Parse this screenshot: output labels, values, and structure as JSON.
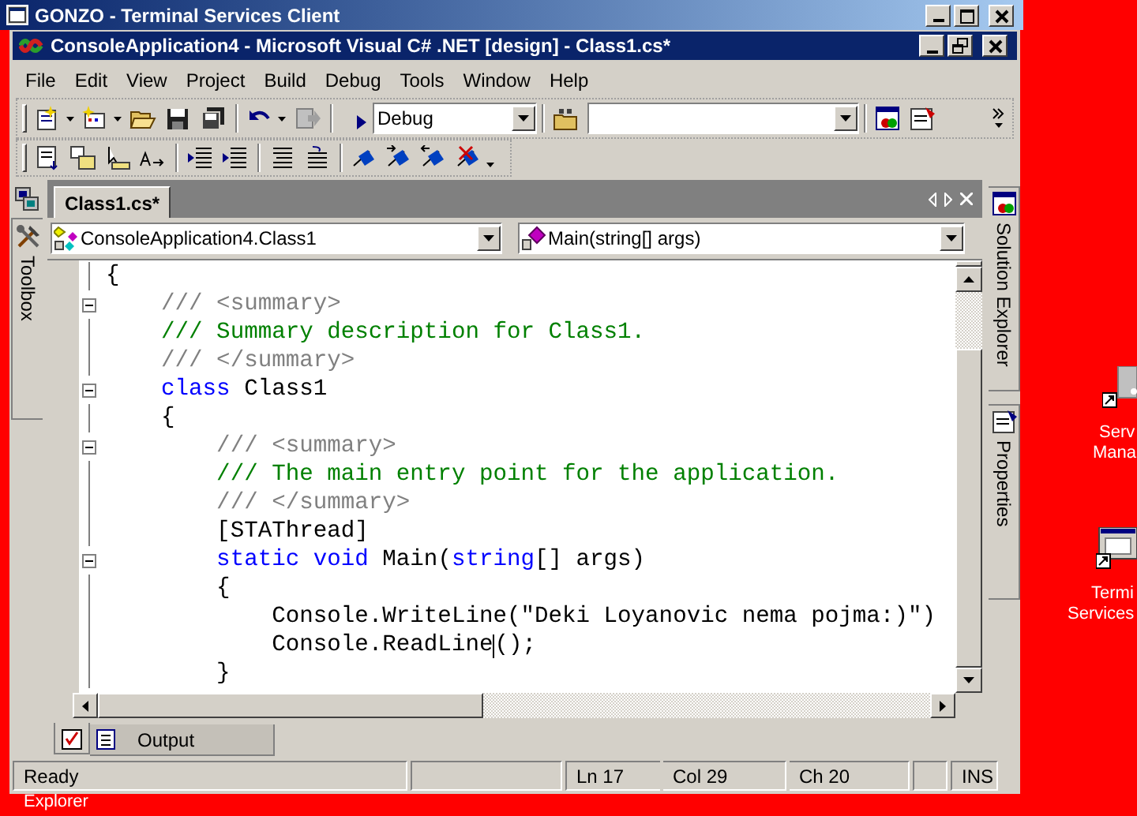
{
  "terminal_window": {
    "title": "GONZO - Terminal Services Client"
  },
  "window": {
    "title": "ConsoleApplication4 - Microsoft Visual C# .NET [design] - Class1.cs*"
  },
  "menu": [
    "File",
    "Edit",
    "View",
    "Project",
    "Build",
    "Debug",
    "Tools",
    "Window",
    "Help"
  ],
  "toolbar": {
    "configuration": "Debug"
  },
  "left_dock": [
    {
      "label": "Toolbox"
    }
  ],
  "right_dock": [
    {
      "label": "Solution Explorer"
    },
    {
      "label": "Properties"
    }
  ],
  "document_tabs": [
    {
      "label": "Class1.cs*",
      "selected": true
    }
  ],
  "type_dropdown": "ConsoleApplication4.Class1",
  "member_dropdown": "Main(string[] args)",
  "code_lines": [
    {
      "fold": false,
      "tokens": [
        {
          "kind": "plain",
          "text": "{"
        }
      ]
    },
    {
      "fold": true,
      "tokens": [
        {
          "kind": "doc_tag",
          "text": "    /// <summary>"
        }
      ]
    },
    {
      "fold": false,
      "tokens": [
        {
          "kind": "comment",
          "text": "    /// Summary description for Class1."
        }
      ]
    },
    {
      "fold": false,
      "tokens": [
        {
          "kind": "doc_tag",
          "text": "    /// </summary>"
        }
      ]
    },
    {
      "fold": true,
      "tokens": [
        {
          "kind": "keyword",
          "text": "    class"
        },
        {
          "kind": "plain",
          "text": " Class1"
        }
      ]
    },
    {
      "fold": false,
      "tokens": [
        {
          "kind": "plain",
          "text": "    {"
        }
      ]
    },
    {
      "fold": true,
      "tokens": [
        {
          "kind": "doc_tag",
          "text": "        /// <summary>"
        }
      ]
    },
    {
      "fold": false,
      "tokens": [
        {
          "kind": "comment",
          "text": "        /// The main entry point for the application."
        }
      ]
    },
    {
      "fold": false,
      "tokens": [
        {
          "kind": "doc_tag",
          "text": "        /// </summary>"
        }
      ]
    },
    {
      "fold": false,
      "tokens": [
        {
          "kind": "plain",
          "text": "        [STAThread]"
        }
      ]
    },
    {
      "fold": true,
      "tokens": [
        {
          "kind": "keyword",
          "text": "        static void"
        },
        {
          "kind": "plain",
          "text": " Main("
        },
        {
          "kind": "keyword",
          "text": "string"
        },
        {
          "kind": "plain",
          "text": "[] args)"
        }
      ]
    },
    {
      "fold": false,
      "tokens": [
        {
          "kind": "plain",
          "text": "        {"
        }
      ]
    },
    {
      "fold": false,
      "tokens": [
        {
          "kind": "plain",
          "text": "            Console.WriteLine(\"Deki Loyanovic nema pojma:)\")"
        }
      ]
    },
    {
      "fold": false,
      "tokens": [
        {
          "kind": "plain",
          "text": "            Console.ReadLine"
        },
        {
          "kind": "caret"
        },
        {
          "kind": "plain",
          "text": "();"
        }
      ]
    },
    {
      "fold": false,
      "tokens": [
        {
          "kind": "plain",
          "text": "        }"
        }
      ]
    }
  ],
  "bottom_tabs": [
    {
      "kind": "task_list",
      "selected": true
    },
    {
      "kind": "output",
      "label": "Output",
      "selected": false
    }
  ],
  "status_bar": [
    {
      "kind": "text",
      "text": "Ready"
    },
    {
      "kind": "blank"
    },
    {
      "kind": "text",
      "text": "Ln 17"
    },
    {
      "kind": "text",
      "text": "Col 29"
    },
    {
      "kind": "text",
      "text": "Ch 20"
    },
    {
      "kind": "blank"
    },
    {
      "kind": "text",
      "text": "INS"
    }
  ],
  "desktop_icons": [
    {
      "label_lines": [
        "Serv",
        "Mana"
      ],
      "kind": "server"
    },
    {
      "label_lines": [
        "Termi",
        "Services"
      ],
      "kind": "terminal"
    }
  ],
  "desktop_text": "Explorer"
}
